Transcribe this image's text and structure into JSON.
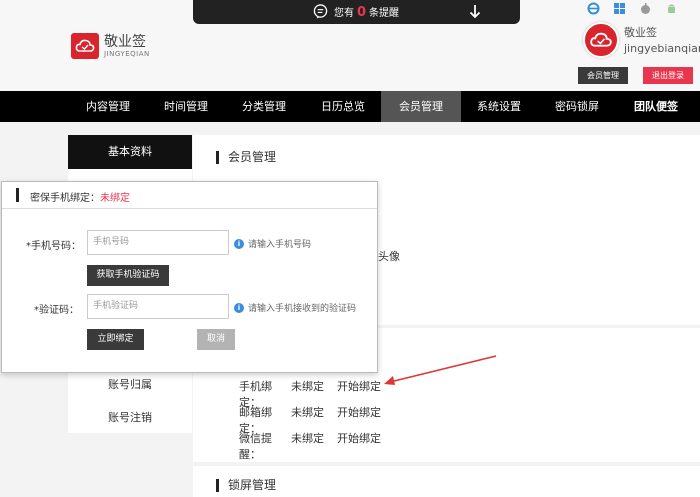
{
  "notice": {
    "prefix": "您有",
    "count": "0",
    "suffix": "条提醒"
  },
  "logo": {
    "cn": "敬业签",
    "en": "JINGYEQIAN"
  },
  "user": {
    "name": "敬业签",
    "id": "jingyebianqian",
    "member_btn": "会员管理",
    "logout_btn": "退出登录"
  },
  "nav": {
    "items": [
      {
        "label": "内容管理"
      },
      {
        "label": "时间管理"
      },
      {
        "label": "分类管理"
      },
      {
        "label": "日历总览"
      },
      {
        "label": "会员管理"
      },
      {
        "label": "系统设置"
      },
      {
        "label": "密码锁屏"
      },
      {
        "label": "团队便签"
      }
    ]
  },
  "sidebar": {
    "active": "基本资料",
    "items": [
      {
        "label": "账号归属"
      },
      {
        "label": "账号注销"
      }
    ]
  },
  "main": {
    "member_title": "会员管理",
    "partial_avatar": "头像",
    "bindings": [
      {
        "label": "手机绑定：",
        "status": "未绑定",
        "action": "开始绑定"
      },
      {
        "label": "邮箱绑定：",
        "status": "未绑定",
        "action": "开始绑定"
      },
      {
        "label": "微信提醒：",
        "status": "未绑定",
        "action": "开始绑定"
      }
    ],
    "lock_title": "锁屏管理"
  },
  "popup": {
    "title": "密保手机绑定：",
    "status": "未绑定",
    "phone_label": "*手机号码：",
    "phone_placeholder": "手机号码",
    "phone_hint": "请输入手机号码",
    "get_code_btn": "获取手机验证码",
    "code_label": "*验证码：",
    "code_placeholder": "手机验证码",
    "code_hint": "请输入手机接收到的验证码",
    "bind_btn": "立即绑定",
    "cancel_btn": "取消"
  },
  "colors": {
    "accent": "#e8364f",
    "brand": "#d9232d",
    "nav_bg": "#000000",
    "hint_icon": "#3b8ede"
  }
}
